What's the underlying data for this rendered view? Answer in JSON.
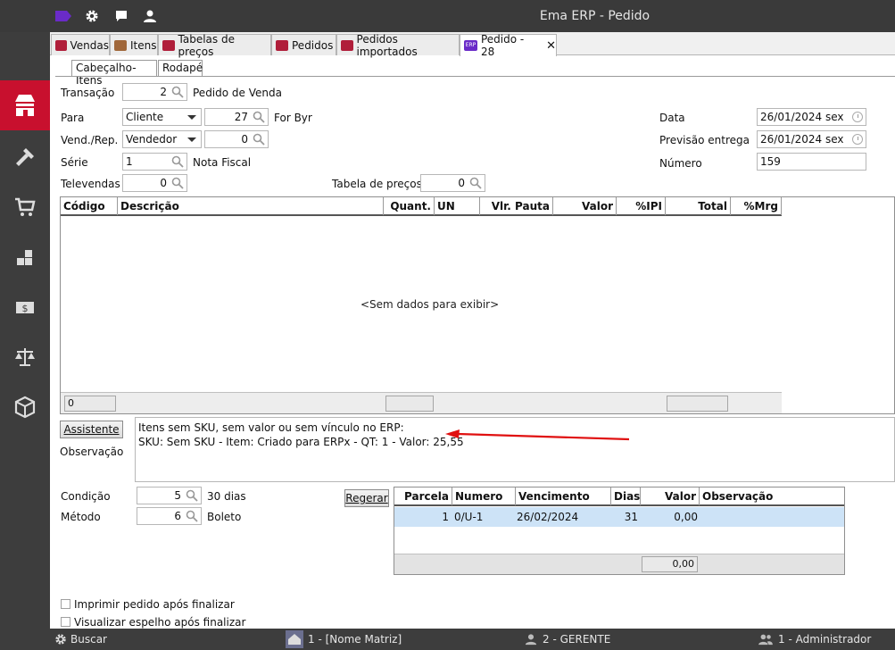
{
  "window": {
    "title": "Ema ERP - Pedido"
  },
  "titlebar_icons": [
    "erp-logo-icon",
    "gear-icon",
    "chat-icon",
    "user-icon"
  ],
  "sidebar": {
    "items": [
      {
        "icon": "store-icon",
        "active": true
      },
      {
        "icon": "tools-icon",
        "active": false
      },
      {
        "icon": "cart-icon",
        "active": false
      },
      {
        "icon": "boxes-icon",
        "active": false
      },
      {
        "icon": "money-icon",
        "active": false
      },
      {
        "icon": "scale-icon",
        "active": false
      },
      {
        "icon": "package-icon",
        "active": false
      }
    ]
  },
  "tabs": [
    {
      "label": "Vendas",
      "color": "#b01e3a"
    },
    {
      "label": "Itens",
      "color": "#a0673a"
    },
    {
      "label": "Tabelas de preços",
      "color": "#b01e3a"
    },
    {
      "label": "Pedidos",
      "color": "#b01e3a"
    },
    {
      "label": "Pedidos importados",
      "color": "#b01e3a"
    },
    {
      "label": "Pedido - 28",
      "color": "#6a2bc8",
      "badge": "ERP",
      "close": "✕"
    }
  ],
  "subtabs": [
    "Cabeçalho-Itens",
    "Rodapé"
  ],
  "form": {
    "transacao": {
      "label": "Transação",
      "value": "2",
      "desc": "Pedido de Venda"
    },
    "para": {
      "label": "Para",
      "select": "Cliente",
      "value": "27",
      "desc": "For Byr"
    },
    "vend": {
      "label": "Vend./Rep.",
      "select": "Vendedor",
      "value": "0"
    },
    "serie": {
      "label": "Série",
      "value": "1",
      "desc": "Nota Fiscal"
    },
    "televendas": {
      "label": "Televendas",
      "value": "0"
    },
    "tabela": {
      "label": "Tabela de preços",
      "value": "0"
    },
    "data": {
      "label": "Data",
      "value": "26/01/2024 sex"
    },
    "previsao": {
      "label": "Previsão entrega",
      "value": "26/01/2024 sex"
    },
    "numero": {
      "label": "Número",
      "value": "159"
    }
  },
  "items_grid": {
    "columns": [
      "Código",
      "Descrição",
      "Quant.",
      "UN",
      "Vlr. Pauta",
      "Valor",
      "%IPI",
      "Total",
      "%Mrg"
    ],
    "sort_icon": "sort-asc-icon",
    "empty_message": "<Sem dados para exibir>",
    "footer_count": "0"
  },
  "assistente_label": "Assistente",
  "observacao": {
    "label": "Observação",
    "line1": "Itens sem SKU, sem valor ou sem vínculo no ERP:",
    "line2": "SKU: Sem SKU - Item: Criado para ERPx - QT: 1 - Valor: 25,55",
    "arrow_color": "#e01010"
  },
  "condicao": {
    "label": "Condição",
    "value": "5",
    "desc": "30 dias"
  },
  "metodo": {
    "label": "Método",
    "value": "6",
    "desc": "Boleto"
  },
  "regerar_label": "Regerar",
  "parcelas_grid": {
    "columns": [
      "Parcela",
      "Numero",
      "Vencimento",
      "Dias",
      "Valor",
      "Observação"
    ],
    "rows": [
      {
        "parcela": "1",
        "numero": "0/U-1",
        "vencimento": "26/02/2024",
        "dias": "31",
        "valor": "0,00",
        "observacao": ""
      }
    ],
    "total": "0,00",
    "selected_color": "#cde3f7"
  },
  "options": [
    {
      "label": "Imprimir pedido após finalizar",
      "checked": false
    },
    {
      "label": "Visualizar espelho após finalizar",
      "checked": false
    }
  ],
  "statusbar": {
    "search": "Buscar",
    "company": "1 - [Nome Matriz]",
    "role": "2 - GERENTE",
    "user": "1 - Administrador"
  },
  "colors": {
    "accent": "#c8102e",
    "dark": "#3a3a3a"
  }
}
